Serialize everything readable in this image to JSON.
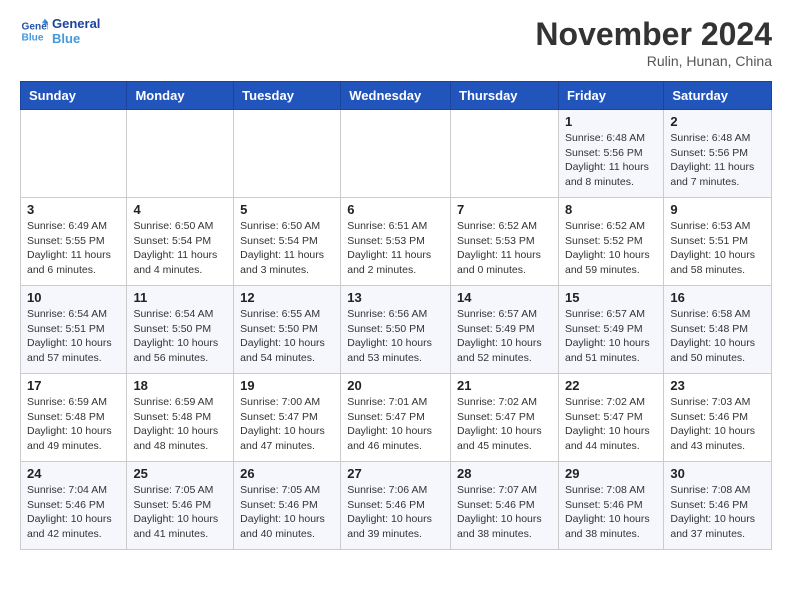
{
  "logo": {
    "line1": "General",
    "line2": "Blue"
  },
  "title": "November 2024",
  "location": "Rulin, Hunan, China",
  "weekdays": [
    "Sunday",
    "Monday",
    "Tuesday",
    "Wednesday",
    "Thursday",
    "Friday",
    "Saturday"
  ],
  "weeks": [
    [
      {
        "day": "",
        "info": ""
      },
      {
        "day": "",
        "info": ""
      },
      {
        "day": "",
        "info": ""
      },
      {
        "day": "",
        "info": ""
      },
      {
        "day": "",
        "info": ""
      },
      {
        "day": "1",
        "info": "Sunrise: 6:48 AM\nSunset: 5:56 PM\nDaylight: 11 hours\nand 8 minutes."
      },
      {
        "day": "2",
        "info": "Sunrise: 6:48 AM\nSunset: 5:56 PM\nDaylight: 11 hours\nand 7 minutes."
      }
    ],
    [
      {
        "day": "3",
        "info": "Sunrise: 6:49 AM\nSunset: 5:55 PM\nDaylight: 11 hours\nand 6 minutes."
      },
      {
        "day": "4",
        "info": "Sunrise: 6:50 AM\nSunset: 5:54 PM\nDaylight: 11 hours\nand 4 minutes."
      },
      {
        "day": "5",
        "info": "Sunrise: 6:50 AM\nSunset: 5:54 PM\nDaylight: 11 hours\nand 3 minutes."
      },
      {
        "day": "6",
        "info": "Sunrise: 6:51 AM\nSunset: 5:53 PM\nDaylight: 11 hours\nand 2 minutes."
      },
      {
        "day": "7",
        "info": "Sunrise: 6:52 AM\nSunset: 5:53 PM\nDaylight: 11 hours\nand 0 minutes."
      },
      {
        "day": "8",
        "info": "Sunrise: 6:52 AM\nSunset: 5:52 PM\nDaylight: 10 hours\nand 59 minutes."
      },
      {
        "day": "9",
        "info": "Sunrise: 6:53 AM\nSunset: 5:51 PM\nDaylight: 10 hours\nand 58 minutes."
      }
    ],
    [
      {
        "day": "10",
        "info": "Sunrise: 6:54 AM\nSunset: 5:51 PM\nDaylight: 10 hours\nand 57 minutes."
      },
      {
        "day": "11",
        "info": "Sunrise: 6:54 AM\nSunset: 5:50 PM\nDaylight: 10 hours\nand 56 minutes."
      },
      {
        "day": "12",
        "info": "Sunrise: 6:55 AM\nSunset: 5:50 PM\nDaylight: 10 hours\nand 54 minutes."
      },
      {
        "day": "13",
        "info": "Sunrise: 6:56 AM\nSunset: 5:50 PM\nDaylight: 10 hours\nand 53 minutes."
      },
      {
        "day": "14",
        "info": "Sunrise: 6:57 AM\nSunset: 5:49 PM\nDaylight: 10 hours\nand 52 minutes."
      },
      {
        "day": "15",
        "info": "Sunrise: 6:57 AM\nSunset: 5:49 PM\nDaylight: 10 hours\nand 51 minutes."
      },
      {
        "day": "16",
        "info": "Sunrise: 6:58 AM\nSunset: 5:48 PM\nDaylight: 10 hours\nand 50 minutes."
      }
    ],
    [
      {
        "day": "17",
        "info": "Sunrise: 6:59 AM\nSunset: 5:48 PM\nDaylight: 10 hours\nand 49 minutes."
      },
      {
        "day": "18",
        "info": "Sunrise: 6:59 AM\nSunset: 5:48 PM\nDaylight: 10 hours\nand 48 minutes."
      },
      {
        "day": "19",
        "info": "Sunrise: 7:00 AM\nSunset: 5:47 PM\nDaylight: 10 hours\nand 47 minutes."
      },
      {
        "day": "20",
        "info": "Sunrise: 7:01 AM\nSunset: 5:47 PM\nDaylight: 10 hours\nand 46 minutes."
      },
      {
        "day": "21",
        "info": "Sunrise: 7:02 AM\nSunset: 5:47 PM\nDaylight: 10 hours\nand 45 minutes."
      },
      {
        "day": "22",
        "info": "Sunrise: 7:02 AM\nSunset: 5:47 PM\nDaylight: 10 hours\nand 44 minutes."
      },
      {
        "day": "23",
        "info": "Sunrise: 7:03 AM\nSunset: 5:46 PM\nDaylight: 10 hours\nand 43 minutes."
      }
    ],
    [
      {
        "day": "24",
        "info": "Sunrise: 7:04 AM\nSunset: 5:46 PM\nDaylight: 10 hours\nand 42 minutes."
      },
      {
        "day": "25",
        "info": "Sunrise: 7:05 AM\nSunset: 5:46 PM\nDaylight: 10 hours\nand 41 minutes."
      },
      {
        "day": "26",
        "info": "Sunrise: 7:05 AM\nSunset: 5:46 PM\nDaylight: 10 hours\nand 40 minutes."
      },
      {
        "day": "27",
        "info": "Sunrise: 7:06 AM\nSunset: 5:46 PM\nDaylight: 10 hours\nand 39 minutes."
      },
      {
        "day": "28",
        "info": "Sunrise: 7:07 AM\nSunset: 5:46 PM\nDaylight: 10 hours\nand 38 minutes."
      },
      {
        "day": "29",
        "info": "Sunrise: 7:08 AM\nSunset: 5:46 PM\nDaylight: 10 hours\nand 38 minutes."
      },
      {
        "day": "30",
        "info": "Sunrise: 7:08 AM\nSunset: 5:46 PM\nDaylight: 10 hours\nand 37 minutes."
      }
    ]
  ]
}
